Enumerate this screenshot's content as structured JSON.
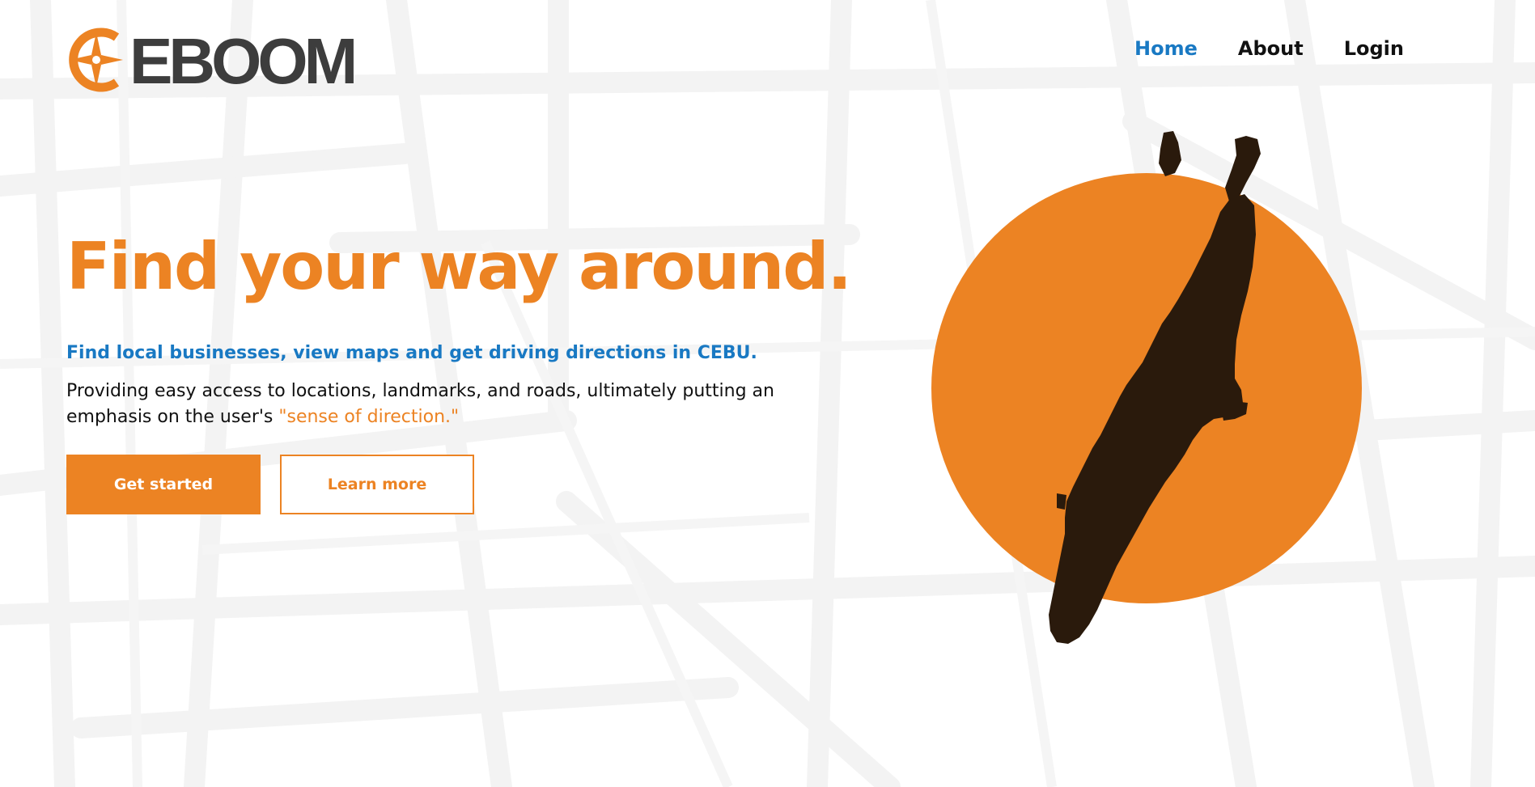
{
  "brand": {
    "name": "EBOOM",
    "logo_icon": "compass-icon",
    "primary_color": "#ec8323",
    "accent_color": "#1979c3",
    "dark_color": "#3d3d3d"
  },
  "nav": {
    "items": [
      {
        "label": "Home",
        "active": true
      },
      {
        "label": "About",
        "active": false
      },
      {
        "label": "Login",
        "active": false
      }
    ]
  },
  "hero": {
    "title": "Find your way around.",
    "tagline": "Find local businesses, view maps and get driving directions in CEBU.",
    "description_prefix": "Providing easy access to locations, landmarks, and roads, ultimately putting an emphasis on the user's ",
    "description_highlight": "\"sense of direction.\"",
    "primary_button": "Get started",
    "secondary_button": "Learn more",
    "graphic": {
      "circle_color": "#ec8323",
      "island_color": "#2a1a0c",
      "island_icon": "cebu-island-map-icon"
    }
  }
}
